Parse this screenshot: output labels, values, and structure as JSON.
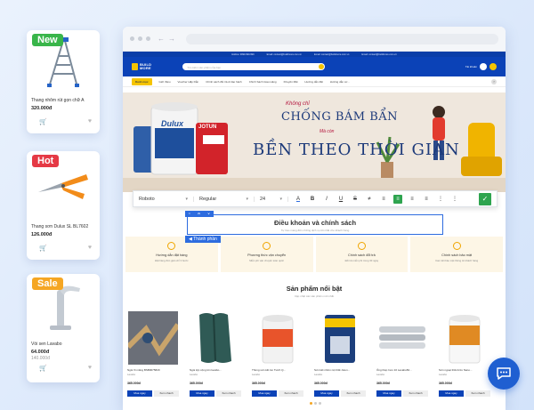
{
  "side_cards": [
    {
      "badge": "New",
      "badge_color": "#39b54a",
      "name": "Thang nhôm rút gọn chữ A",
      "price": "320.000đ",
      "old_price": ""
    },
    {
      "badge": "Hot",
      "badge_color": "#e53945",
      "name": "Thang sơn Dulux SL BL7602",
      "price": "126.000đ",
      "old_price": ""
    },
    {
      "badge": "Sale",
      "badge_color": "#f5a623",
      "name": "Vòi sen Lavabo",
      "price": "64.000đ",
      "old_price": "140.000đ"
    }
  ],
  "site": {
    "logo_line1": "BUILD",
    "logo_line2": "MORE",
    "top_contacts": [
      "Hotline: 0999.999.999",
      "Email: contact@buildmore.com.vn",
      "Email: contact@buildmore.com.vn",
      "Email: contact@buildmore.com.vn"
    ],
    "search_placeholder": "Tìm kiếm sản phẩm của bạn",
    "account_label": "Tài khoản",
    "cart_count": "0",
    "menu": {
      "category": "Danh mục",
      "items": [
        "Giới thiệu",
        "Voucher Hấp Dẫn",
        "Chính sách đổi trả & bảo hành",
        "Chính Sách Giao Hàng",
        "Khuyến Mãi",
        "Hướng dẫn đặt",
        "Hướng dẫn cơ..."
      ]
    }
  },
  "banner": {
    "line1": "Không chỉ",
    "line2": "CHỐNG BÁM BẨN",
    "line3": "Mà còn",
    "line4": "BỀN THEO THỜI GIAN",
    "dulux_label": "Dulux",
    "jotun_label": "JOTUN"
  },
  "toolbar": {
    "font": "Roboto",
    "weight": "Regular",
    "size": "24",
    "color_accent": "#2ea44f"
  },
  "section": {
    "title": "Điều khoản và chính sách",
    "subtitle": "Tự hào mang đến những dịch vụ tốt nhất cho khách hàng",
    "component_tag": "Thành phần"
  },
  "policies": [
    {
      "title": "Hướng dẫn đặt hàng",
      "desc": "Đặt hàng đơn giản chỉ 3 bước"
    },
    {
      "title": "Phương thức vận chuyển",
      "desc": "Miễn phí vận chuyển toàn quốc"
    },
    {
      "title": "Chính sách đổi trả",
      "desc": "Đổi trả miễn phí trong 30 ngày"
    },
    {
      "title": "Chính sách bảo mật",
      "desc": "Cam kết bảo mật thông tin khách hàng"
    }
  ],
  "featured": {
    "title": "Sản phẩm nổi bật",
    "subtitle": "Cập nhật các sản phẩm mới nhất",
    "buy_label": "Mua ngay",
    "view_label": "Xem nhanh",
    "products": [
      {
        "name": "Ngói Xi măng BSB0075820",
        "brand": "Lavabo",
        "price": "365.000đ"
      },
      {
        "name": "Ngói lợp cộng tôn lavabo...",
        "brand": "Lavabo",
        "price": "365.000đ"
      },
      {
        "name": "Thùng sơn kết lon Tuích Q...",
        "brand": "Lavabo",
        "price": "365.000đ"
      },
      {
        "name": "Sơn kết nhôm nội thất Jotun...",
        "brand": "Lavabo",
        "price": "365.000đ"
      },
      {
        "name": "Ống thép Inox 10 Lavabo84...",
        "brand": "Lavabo",
        "price": "365.000đ"
      },
      {
        "name": "Sơn ngoại thất Azzo Nano...",
        "brand": "Lavabo",
        "price": "365.000đ"
      }
    ]
  },
  "icons": [
    "cart-icon",
    "heart-icon",
    "chat-icon",
    "check-icon"
  ]
}
